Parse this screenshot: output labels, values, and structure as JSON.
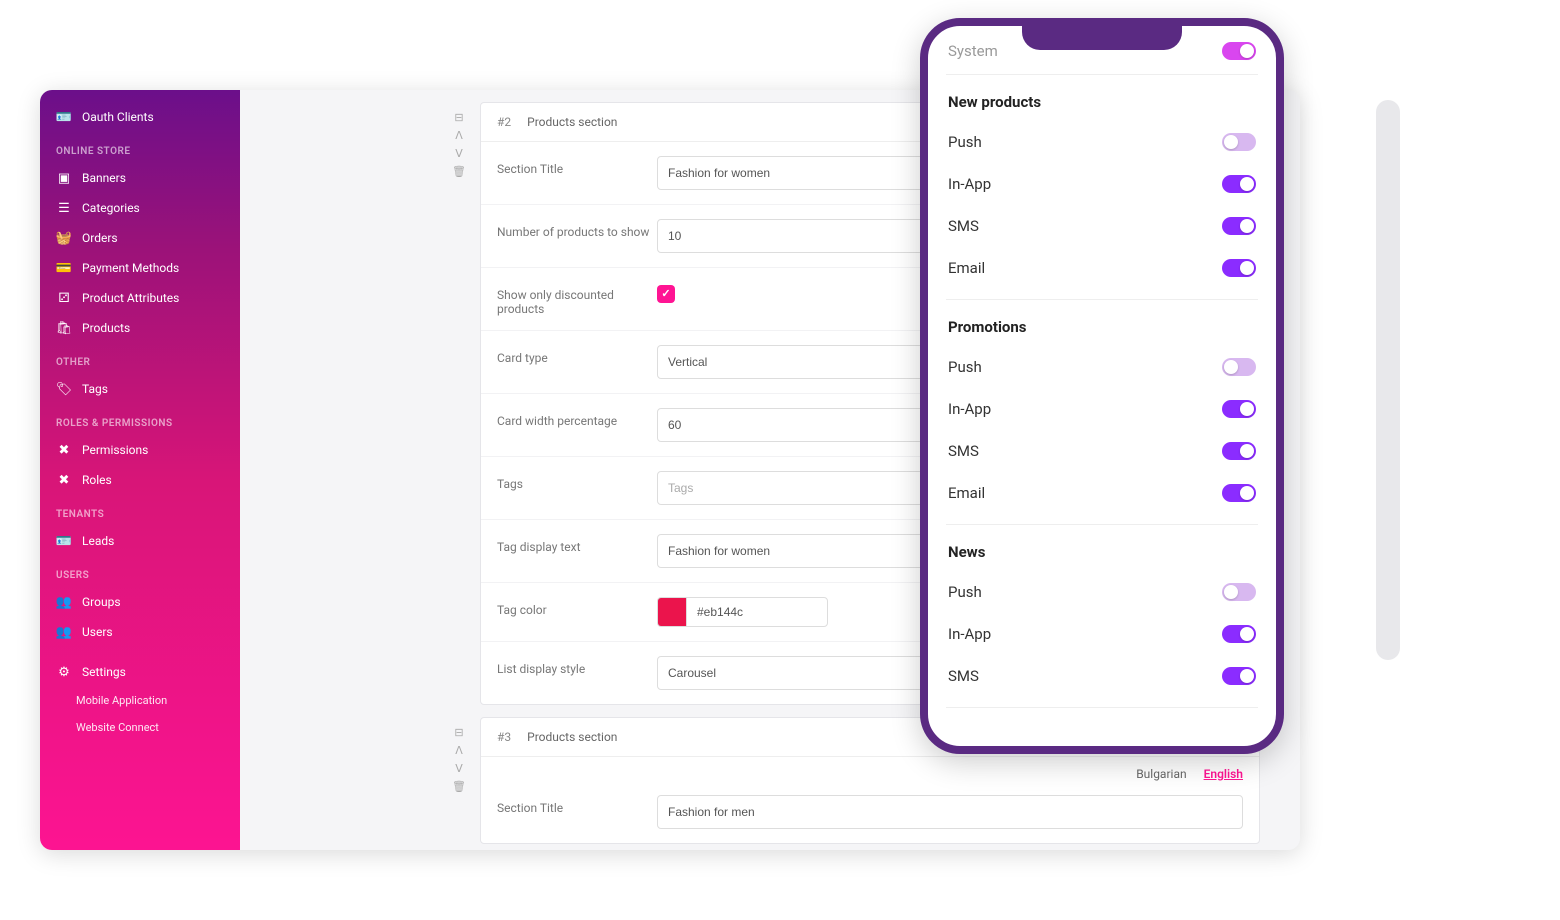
{
  "sidebar": {
    "top_item": "Oauth Clients",
    "sections": [
      {
        "title": "ONLINE STORE",
        "items": [
          "Banners",
          "Categories",
          "Orders",
          "Payment Methods",
          "Product Attributes",
          "Products"
        ]
      },
      {
        "title": "OTHER",
        "items": [
          "Tags"
        ]
      },
      {
        "title": "ROLES & PERMISSIONS",
        "items": [
          "Permissions",
          "Roles"
        ]
      },
      {
        "title": "TENANTS",
        "items": [
          "Leads"
        ]
      },
      {
        "title": "USERS",
        "items": [
          "Groups",
          "Users"
        ]
      }
    ],
    "settings": "Settings",
    "settings_sub": [
      "Mobile Application",
      "Website Connect"
    ]
  },
  "section2": {
    "number": "#2",
    "title": "Products section",
    "fields": {
      "section_title_label": "Section Title",
      "section_title_value": "Fashion for women",
      "num_products_label": "Number of products to show",
      "num_products_value": "10",
      "show_discounted_label": "Show only discounted products",
      "card_type_label": "Card type",
      "card_type_value": "Vertical",
      "card_width_label": "Card width percentage",
      "card_width_value": "60",
      "tags_label": "Tags",
      "tags_placeholder": "Tags",
      "tag_display_label": "Tag display text",
      "tag_display_value": "Fashion for women",
      "tag_color_label": "Tag color",
      "tag_color_value": "#eb144c",
      "list_style_label": "List display style",
      "list_style_value": "Carousel"
    }
  },
  "section3": {
    "number": "#3",
    "title": "Products section",
    "section_title_label": "Section Title",
    "section_title_value": "Fashion for men"
  },
  "languages": {
    "inactive": "Bulgarian",
    "active": "English"
  },
  "phone": {
    "system_label": "System",
    "groups": [
      {
        "title": "New products",
        "rows": [
          {
            "label": "Push",
            "on": false
          },
          {
            "label": "In-App",
            "on": true
          },
          {
            "label": "SMS",
            "on": true
          },
          {
            "label": "Email",
            "on": true
          }
        ]
      },
      {
        "title": "Promotions",
        "rows": [
          {
            "label": "Push",
            "on": false
          },
          {
            "label": "In-App",
            "on": true
          },
          {
            "label": "SMS",
            "on": true
          },
          {
            "label": "Email",
            "on": true
          }
        ]
      },
      {
        "title": "News",
        "rows": [
          {
            "label": "Push",
            "on": false
          },
          {
            "label": "In-App",
            "on": true
          },
          {
            "label": "SMS",
            "on": true
          }
        ]
      }
    ]
  }
}
